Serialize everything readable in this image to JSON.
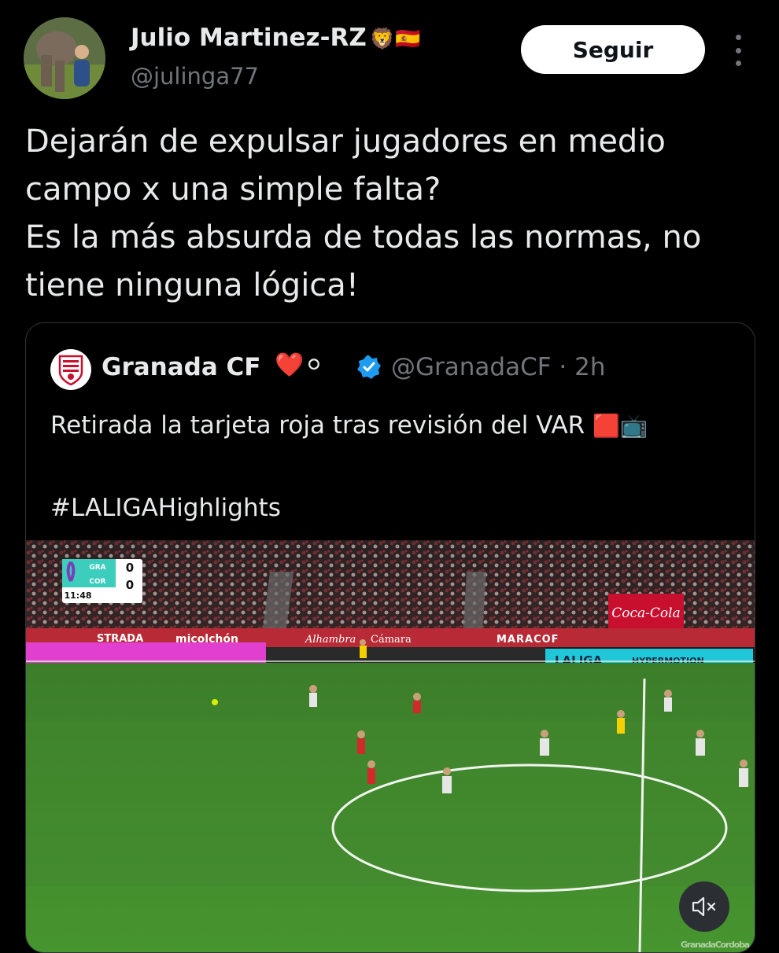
{
  "author": {
    "name": "Julio Martinez-RZ",
    "name_emoji": "🦁🇪🇸",
    "handle": "@julinga77"
  },
  "follow_button": {
    "label": "Seguir"
  },
  "tweet": {
    "text": "Dejarán de expulsar jugadores en medio\ncampo x una simple falta?\nEs la más absurda de todas las normas, no\ntiene ninguna lógica!"
  },
  "quoted": {
    "name": "Granada CF",
    "name_emoji": "❤️⚪",
    "handle_time": "@GranadaCF · 2h",
    "text_main": "Retirada la tarjeta roja tras revisión del VAR",
    "text_emoji": "🟥📺",
    "hashtag": "#LALIGAHighlights"
  },
  "video": {
    "scoreboard": {
      "home_team": "GRA",
      "away_team": "COR",
      "home_score": "0",
      "away_score": "0",
      "clock": "11:48"
    },
    "ad_boards": [
      "STRADA",
      "micolchón",
      "Alhambra",
      "Cámara",
      "MARACOF"
    ],
    "coca_cola": "Coca-Cola",
    "laliga_board": "LALIGA",
    "hypermotion": "HYPERMOTION",
    "watermark": "GranadaCordoba"
  },
  "colors": {
    "background": "#000000",
    "text_primary": "#e7e9ea",
    "text_secondary": "#71767b",
    "verified_blue": "#1d9bf0",
    "pitch_green": "#3f8a2c"
  },
  "icons": {
    "more": "more-vertical-icon",
    "verified": "verified-badge-icon",
    "mute": "speaker-muted-icon"
  }
}
